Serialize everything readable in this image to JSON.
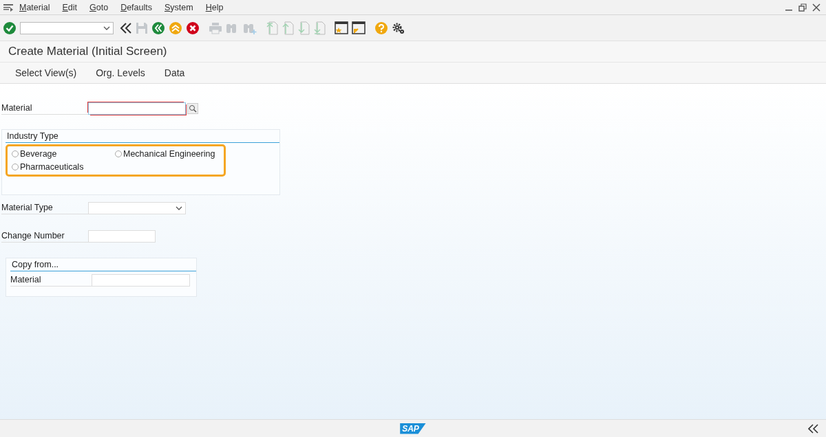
{
  "menu_bar": {
    "items": [
      "Material",
      "Edit",
      "Goto",
      "Defaults",
      "System",
      "Help"
    ]
  },
  "toolbar": {
    "items": [
      {
        "kind": "enter",
        "disabled": false
      },
      {
        "kind": "command-field",
        "disabled": false
      },
      {
        "kind": "double-left",
        "disabled": false
      },
      {
        "kind": "save",
        "disabled": true
      },
      {
        "kind": "back",
        "disabled": false
      },
      {
        "kind": "exit",
        "disabled": false
      },
      {
        "kind": "cancel",
        "disabled": false
      },
      {
        "kind": "print",
        "disabled": true
      },
      {
        "kind": "find",
        "disabled": true
      },
      {
        "kind": "find-next",
        "disabled": true
      },
      {
        "kind": "first-page",
        "disabled": true
      },
      {
        "kind": "prev-page",
        "disabled": true
      },
      {
        "kind": "next-page",
        "disabled": true
      },
      {
        "kind": "last-page",
        "disabled": true
      },
      {
        "kind": "new-session",
        "disabled": false
      },
      {
        "kind": "shortcut",
        "disabled": false
      },
      {
        "kind": "help",
        "disabled": false
      },
      {
        "kind": "settings",
        "disabled": false
      }
    ]
  },
  "title": "Create Material (Initial Screen)",
  "app_toolbar": {
    "items": [
      "Select View(s)",
      "Org. Levels",
      "Data"
    ]
  },
  "form": {
    "material": {
      "label": "Material",
      "required": true
    },
    "industry_type": {
      "title": "Industry Type",
      "highlighted": true,
      "options": [
        {
          "label": "Beverage",
          "selected": false
        },
        {
          "label": "Mechanical Engineering",
          "selected": false
        },
        {
          "label": "Pharmaceuticals",
          "selected": false
        }
      ]
    },
    "material_type": {
      "label": "Material Type"
    },
    "change_number": {
      "label": "Change Number"
    },
    "copy_from": {
      "title": "Copy from...",
      "material_label": "Material"
    }
  },
  "status_bar": {
    "logo": "SAP"
  }
}
